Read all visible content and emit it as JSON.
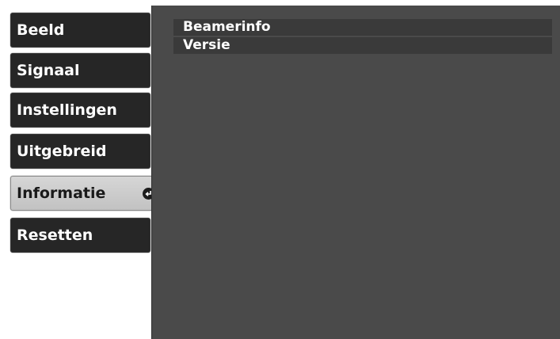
{
  "menu": {
    "items": [
      {
        "label": "Beeld"
      },
      {
        "label": "Signaal"
      },
      {
        "label": "Instellingen"
      },
      {
        "label": "Uitgebreid"
      },
      {
        "label": "Informatie",
        "selected": true,
        "icon": "enter-return-icon"
      },
      {
        "label": "Resetten"
      }
    ]
  },
  "panel": {
    "rows": [
      {
        "label": "Beamerinfo"
      },
      {
        "label": "Versie"
      }
    ]
  },
  "colors": {
    "menu_bg": "#262626",
    "selected_bg": "#c8c8c8",
    "panel_bg": "#4a4a4a",
    "row_bg": "#3a3a3a"
  }
}
